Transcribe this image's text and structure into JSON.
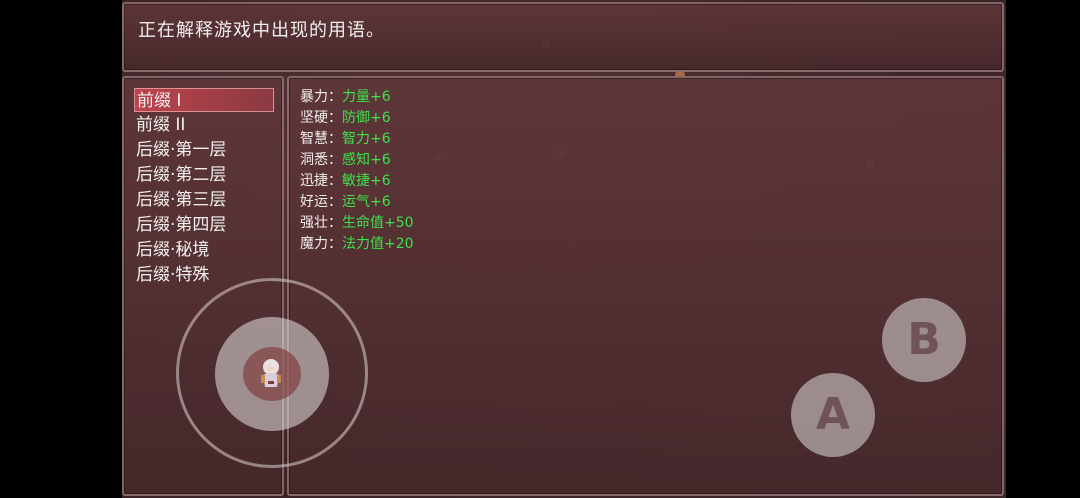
{
  "help": {
    "text": "正在解释游戏中出现的用语。"
  },
  "categories": [
    {
      "label": "前缀 I",
      "selected": true
    },
    {
      "label": "前缀 II",
      "selected": false
    },
    {
      "label": "后缀·第一层",
      "selected": false
    },
    {
      "label": "后缀·第二层",
      "selected": false
    },
    {
      "label": "后缀·第三层",
      "selected": false
    },
    {
      "label": "后缀·第四层",
      "selected": false
    },
    {
      "label": "后缀·秘境",
      "selected": false
    },
    {
      "label": "后缀·特殊",
      "selected": false
    }
  ],
  "effects": [
    {
      "name": "暴力",
      "sep": "：",
      "value": "力量+6"
    },
    {
      "name": "坚硬",
      "sep": "：",
      "value": "防御+6"
    },
    {
      "name": "智慧",
      "sep": "：",
      "value": "智力+6"
    },
    {
      "name": "洞悉",
      "sep": "：",
      "value": "感知+6"
    },
    {
      "name": "迅捷",
      "sep": "：",
      "value": "敏捷+6"
    },
    {
      "name": "好运",
      "sep": "：",
      "value": "运气+6"
    },
    {
      "name": "强壮",
      "sep": "：",
      "value": "生命值+50"
    },
    {
      "name": "魔力",
      "sep": "：",
      "value": "法力值+20"
    }
  ],
  "controls": {
    "b_label": "B",
    "a_label": "A"
  },
  "colors": {
    "value_green": "#3fe04a",
    "selection": "#cd4650"
  }
}
